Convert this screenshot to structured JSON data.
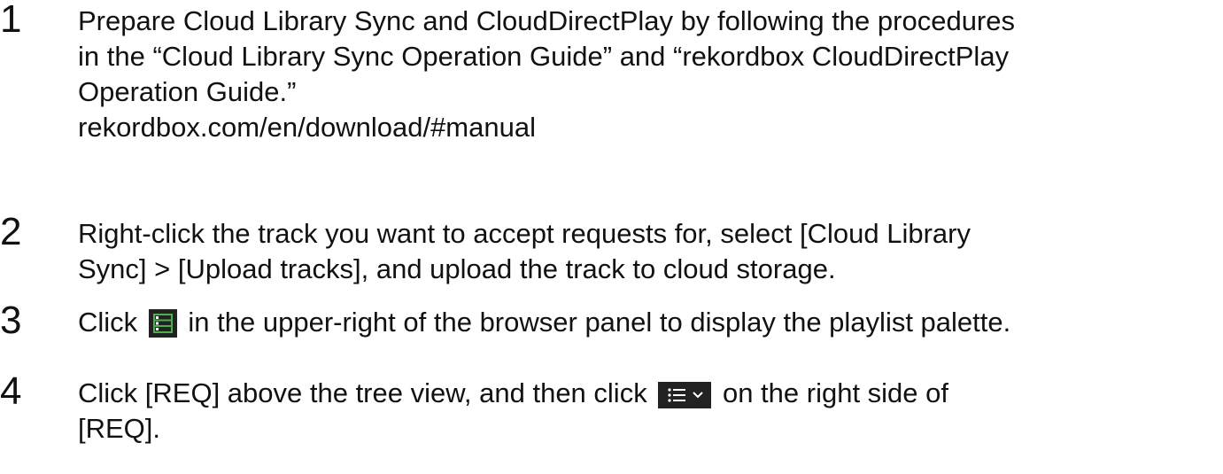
{
  "steps": [
    {
      "number": "1",
      "lines": [
        "Prepare Cloud Library Sync and CloudDirectPlay by following the procedures",
        "in the “Cloud Library Sync Operation Guide” and “rekordbox CloudDirectPlay",
        "Operation Guide.”",
        "rekordbox.com/en/download/#manual"
      ]
    },
    {
      "number": "2",
      "lines": [
        "Right-click the track you want to accept requests for, select [Cloud Library",
        "Sync] > [Upload tracks], and upload the track to cloud storage."
      ]
    },
    {
      "number": "3",
      "before_icon": "Click",
      "icon": "playlist-palette-icon",
      "after_icon": "in the upper-right of the browser panel to display the playlist palette."
    },
    {
      "number": "4",
      "before_icon": "Click [REQ] above the tree view, and then click",
      "icon": "list-view-dropdown-icon",
      "after_icon": "on the right side of",
      "line2": "[REQ]."
    }
  ],
  "colors": {
    "text": "#111111",
    "icon_bg": "#222222",
    "icon_fg": "#ffffff",
    "icon_green": "#4caf50"
  }
}
